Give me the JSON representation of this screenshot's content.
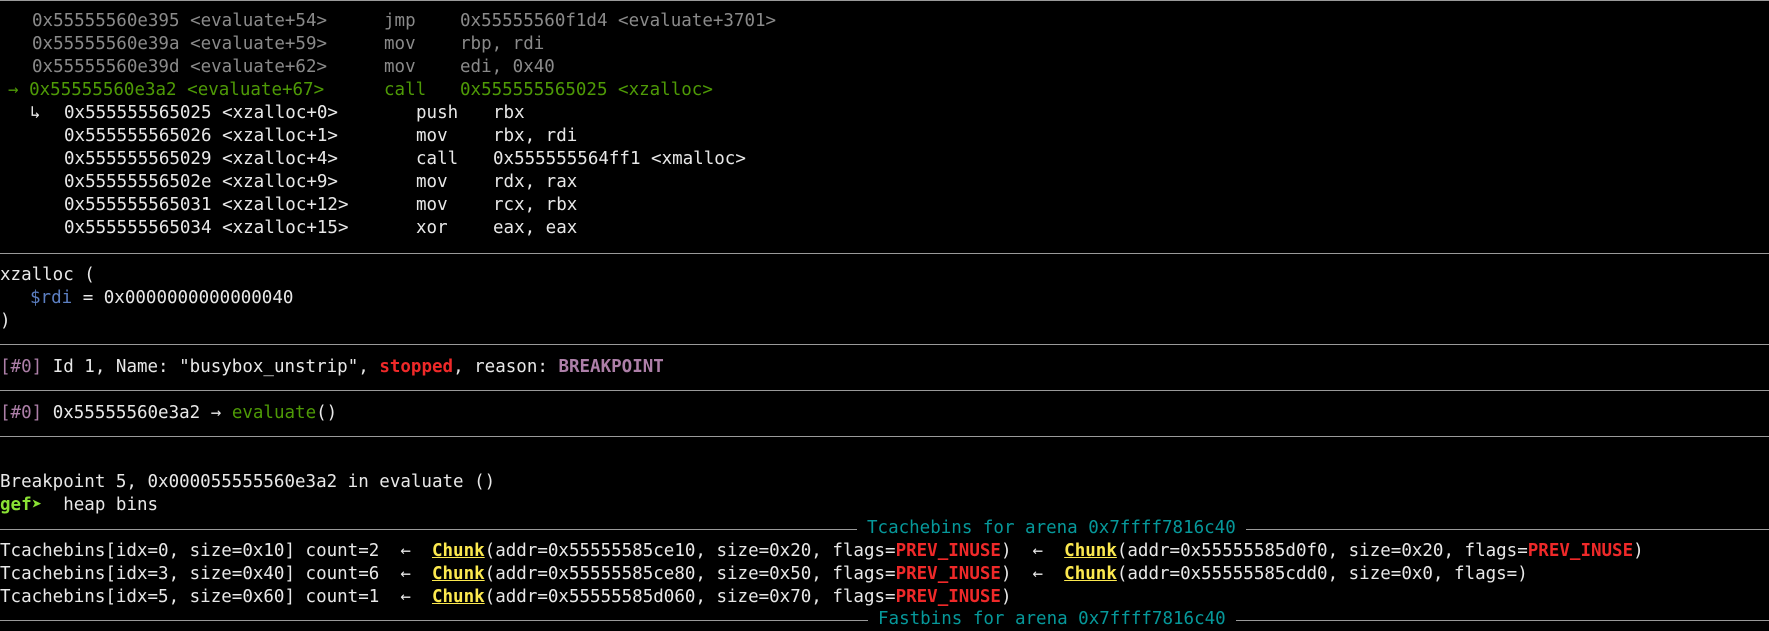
{
  "disasm_prev": [
    {
      "addr": "0x55555560e395",
      "sym": "<evaluate+54>",
      "op": "jmp",
      "args": "0x55555560f1d4 <evaluate+3701>"
    },
    {
      "addr": "0x55555560e39a",
      "sym": "<evaluate+59>",
      "op": "mov",
      "args": "rbp, rdi"
    },
    {
      "addr": "0x55555560e39d",
      "sym": "<evaluate+62>",
      "op": "mov",
      "args": "edi, 0x40"
    }
  ],
  "disasm_current": {
    "arrow": "→",
    "addr": "0x55555560e3a2",
    "sym": "<evaluate+67>",
    "op": "call",
    "args": "0x555555565025 <xzalloc>"
  },
  "disasm_target": [
    {
      "prefix": "↳",
      "addr": "0x555555565025",
      "sym": "<xzalloc+0>",
      "op": "push",
      "args": "rbx"
    },
    {
      "prefix": "",
      "addr": "0x555555565026",
      "sym": "<xzalloc+1>",
      "op": "mov",
      "args": "rbx, rdi"
    },
    {
      "prefix": "",
      "addr": "0x555555565029",
      "sym": "<xzalloc+4>",
      "op": "call",
      "args": "0x555555564ff1 <xmalloc>"
    },
    {
      "prefix": "",
      "addr": "0x55555556502e",
      "sym": "<xzalloc+9>",
      "op": "mov",
      "args": "rdx, rax"
    },
    {
      "prefix": "",
      "addr": "0x555555565031",
      "sym": "<xzalloc+12>",
      "op": "mov",
      "args": "rcx, rbx"
    },
    {
      "prefix": "",
      "addr": "0x555555565034",
      "sym": "<xzalloc+15>",
      "op": "xor",
      "args": "eax, eax"
    }
  ],
  "args_section": {
    "open": "xzalloc (",
    "reg": "$rdi",
    "eq": " = 0x0000000000000040",
    "close": ")"
  },
  "threads": {
    "idx": "[#0]",
    "info": " Id 1, Name: \"busybox_unstrip\", ",
    "state": "stopped",
    "reason_label": ", reason: ",
    "reason": "BREAKPOINT"
  },
  "trace": {
    "idx": "[#0]",
    "addr": " 0x55555560e3a2 → ",
    "func": "evaluate",
    "parens": "()"
  },
  "breakpoint_msg": "Breakpoint 5, 0x000055555560e3a2 in evaluate ()",
  "prompt": {
    "label": "gef➤",
    "command": "  heap bins"
  },
  "tcache_header": "Tcachebins for arena 0x7ffff7816c40",
  "tcache_rows": [
    {
      "prefix": "Tcachebins[idx=0, size=0x10] count=2  ←  ",
      "chunks": [
        {
          "word": "Chunk",
          "body": "(addr=0x55555585ce10, size=0x20, flags=",
          "flag": "PREV_INUSE",
          "end": ")"
        },
        {
          "word": "Chunk",
          "body": "(addr=0x55555585d0f0, size=0x20, flags=",
          "flag": "PREV_INUSE",
          "end": ")"
        }
      ]
    },
    {
      "prefix": "Tcachebins[idx=3, size=0x40] count=6  ←  ",
      "chunks": [
        {
          "word": "Chunk",
          "body": "(addr=0x55555585ce80, size=0x50, flags=",
          "flag": "PREV_INUSE",
          "end": ")"
        },
        {
          "word": "Chunk",
          "body": "(addr=0x55555585cdd0, size=0x0, flags=",
          "flag": "",
          "end": ")"
        }
      ]
    },
    {
      "prefix": "Tcachebins[idx=5, size=0x60] count=1  ←  ",
      "chunks": [
        {
          "word": "Chunk",
          "body": "(addr=0x55555585d060, size=0x70, flags=",
          "flag": "PREV_INUSE",
          "end": ")"
        }
      ]
    }
  ],
  "chunk_sep": "  ←  ",
  "fastbins_header": "Fastbins for arena 0x7ffff7816c40",
  "colors": {
    "background": "#000000",
    "text": "#e8e8e8",
    "current_line": "#4e9a06",
    "flag": "#ef2929",
    "chunk": "#fce94f",
    "header": "#06989a"
  }
}
